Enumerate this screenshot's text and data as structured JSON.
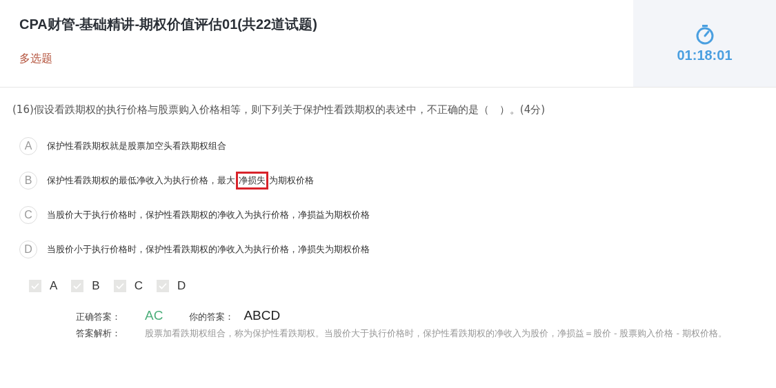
{
  "header": {
    "title": "CPA财管-基础精讲-期权价值评估01(共22道试题)",
    "question_type": "多选题",
    "timer": "01:18:01"
  },
  "question": {
    "text": "(16)假设看跌期权的执行价格与股票购入价格相等，则下列关于保护性看跌期权的表述中，不正确的是（　）。(4分)",
    "options": [
      {
        "letter": "A",
        "segments": [
          {
            "text": "保护性看跌期权就是股票加空头看跌期权组合",
            "highlighted": false
          }
        ]
      },
      {
        "letter": "B",
        "segments": [
          {
            "text": "保护性看跌期权的最低净收入为执行价格，最大",
            "highlighted": false
          },
          {
            "text": "净损失",
            "highlighted": true
          },
          {
            "text": "为期权价格",
            "highlighted": false
          }
        ]
      },
      {
        "letter": "C",
        "segments": [
          {
            "text": "当股价大于执行价格时，保护性看跌期权的净收入为执行价格，净损益为期权价格",
            "highlighted": false
          }
        ]
      },
      {
        "letter": "D",
        "segments": [
          {
            "text": "当股价小于执行价格时，保护性看跌期权的净收入为执行价格，净损失为期权价格",
            "highlighted": false
          }
        ]
      }
    ]
  },
  "choices": [
    {
      "label": "A",
      "checked": true
    },
    {
      "label": "B",
      "checked": true
    },
    {
      "label": "C",
      "checked": true
    },
    {
      "label": "D",
      "checked": true
    }
  ],
  "answer": {
    "correct_label": "正确答案：",
    "correct": "AC",
    "yours_label": "你的答案：",
    "yours": "ABCD",
    "analysis_label": "答案解析：",
    "analysis": "股票加看跌期权组合，称为保护性看跌期权。当股价大于执行价格时，保护性看跌期权的净收入为股价，净损益＝股价 - 股票购入价格 - 期权价格。"
  }
}
